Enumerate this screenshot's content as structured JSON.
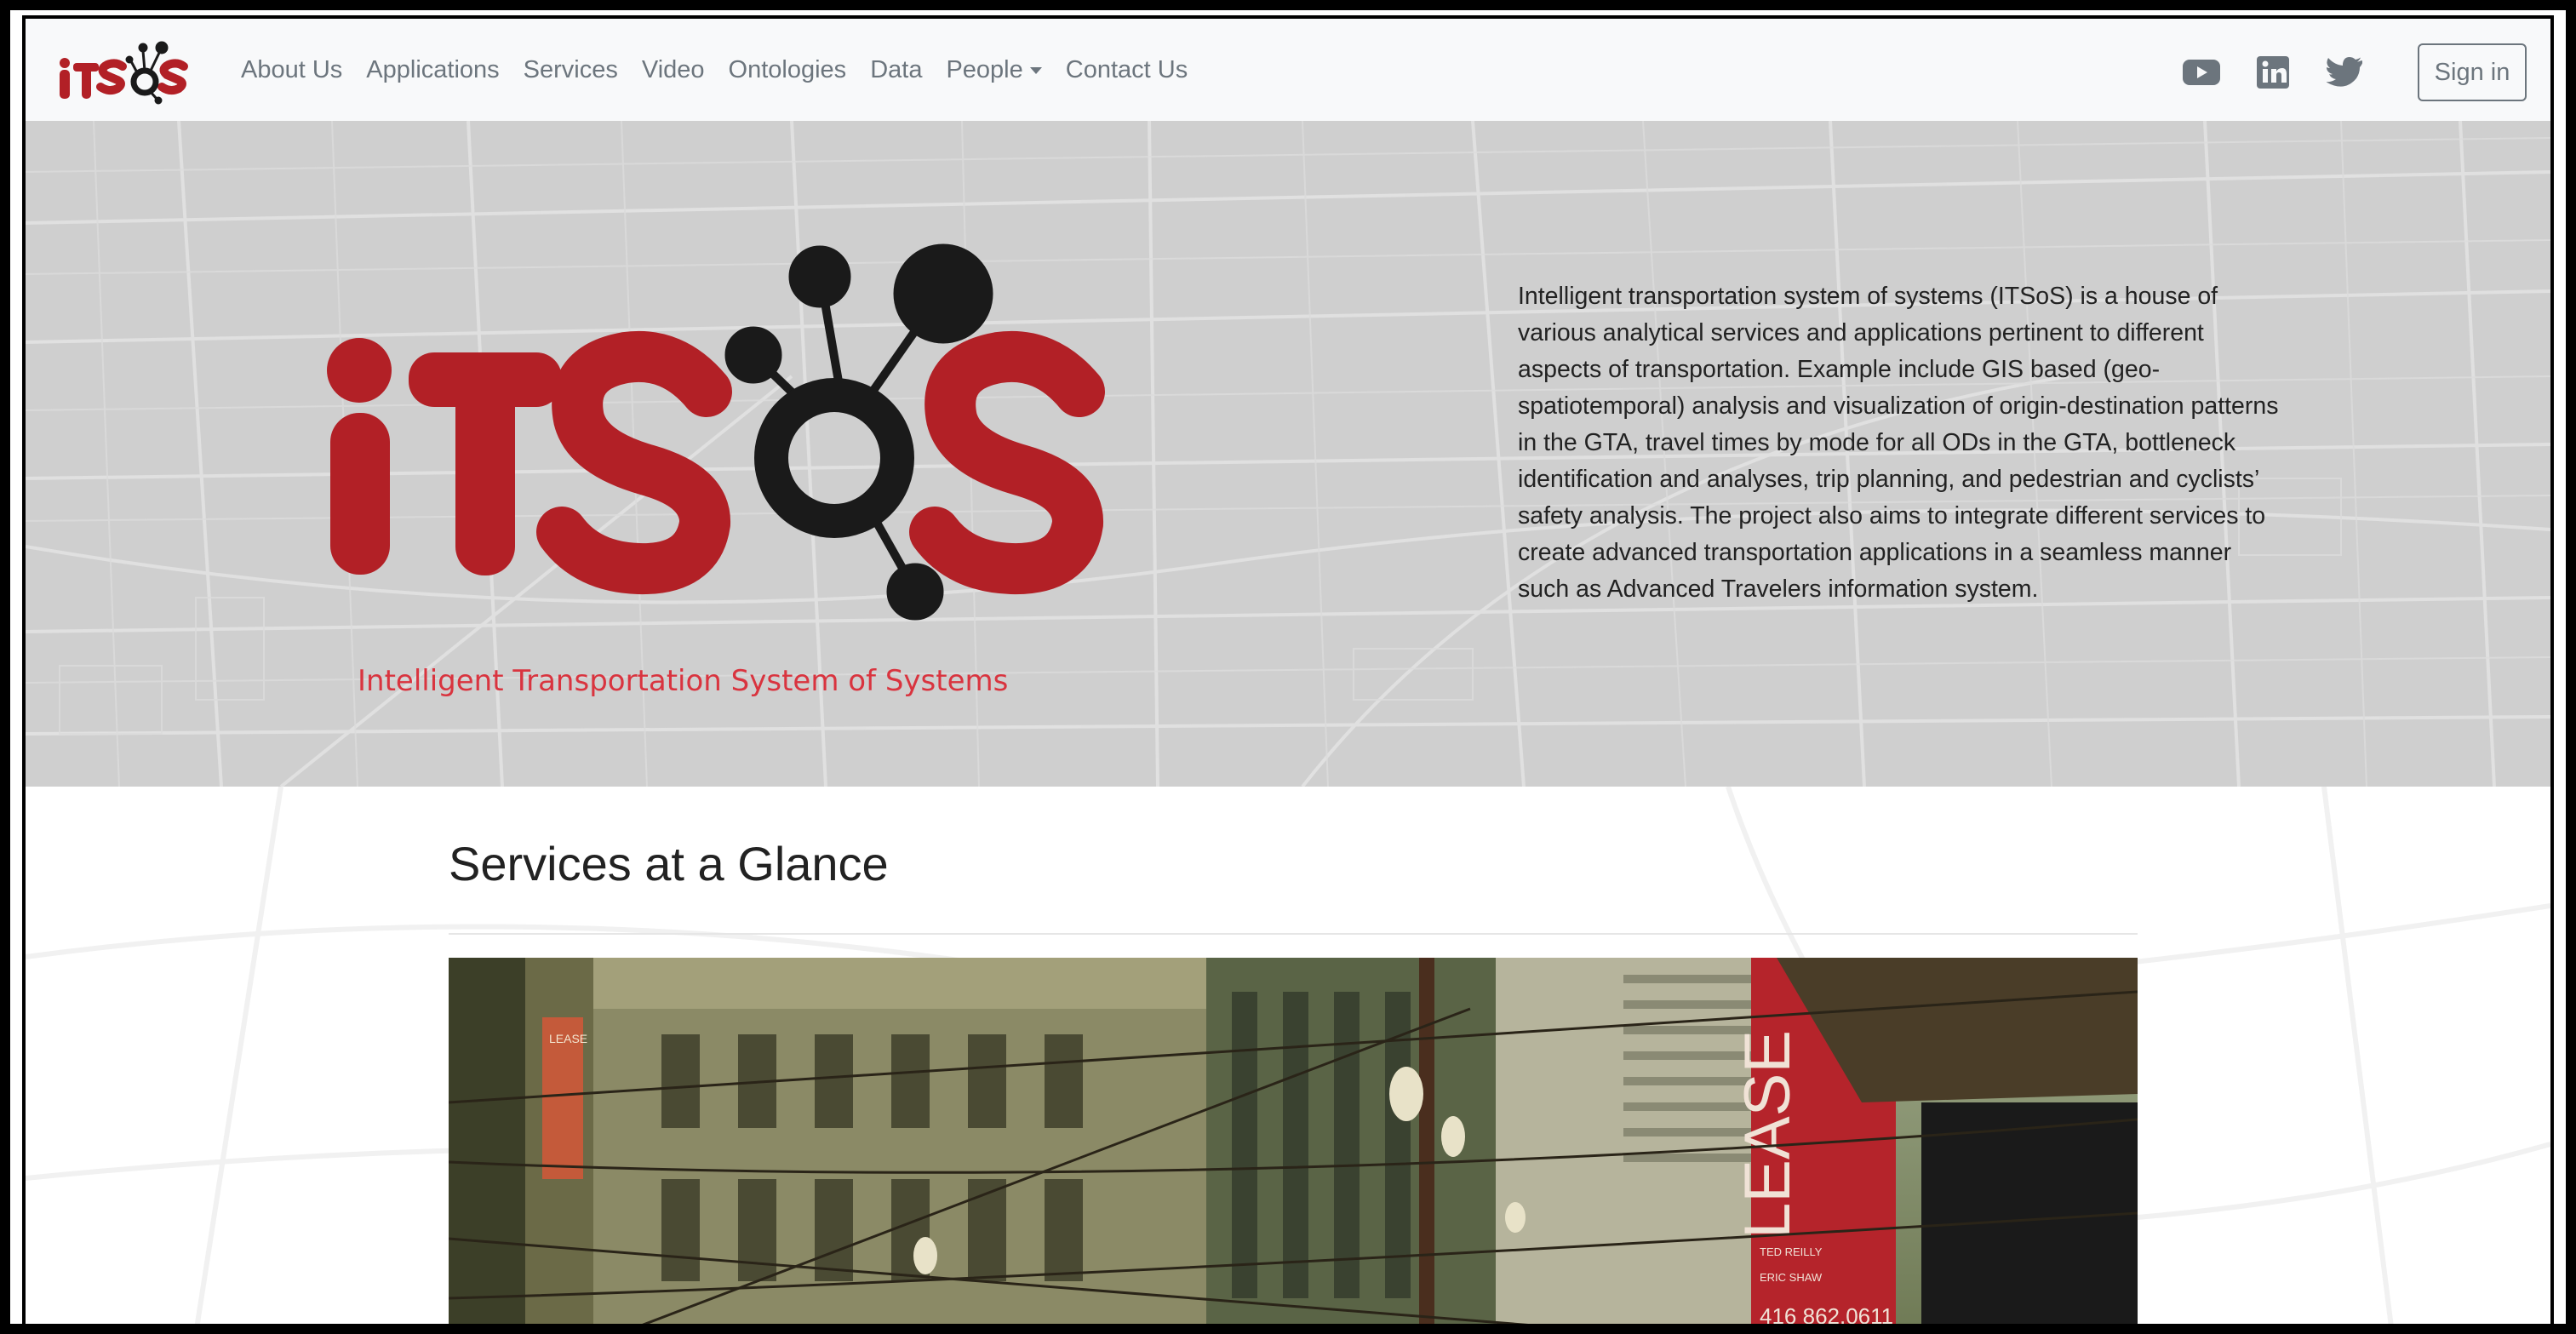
{
  "brand": {
    "logo_text": "iTSoS",
    "accent_color": "#b22026",
    "dark_color": "#1a1a1a"
  },
  "nav": {
    "links": [
      {
        "label": "About Us"
      },
      {
        "label": "Applications"
      },
      {
        "label": "Services"
      },
      {
        "label": "Video"
      },
      {
        "label": "Ontologies"
      },
      {
        "label": "Data"
      },
      {
        "label": "People",
        "has_dropdown": true
      },
      {
        "label": "Contact Us"
      }
    ],
    "social_icons": [
      "youtube-icon",
      "linkedin-icon",
      "twitter-icon"
    ],
    "signin_label": "Sign in"
  },
  "hero": {
    "logo_text": "iTSoS",
    "tagline": "Intelligent Transportation System of Systems",
    "description": "Intelligent transportation system of systems (ITSoS) is a house of various analytical services and applications pertinent to different aspects of transportation. Example include GIS based (geo-spatiotemporal) analysis and visualization of origin-destination patterns in the GTA, travel times by mode for all ODs in the GTA, bottleneck identification and analyses, trip planning, and pedestrian and cyclists’ safety analysis. The project also aims to integrate different services to create advanced transportation applications in a seamless manner such as Advanced Travelers information system."
  },
  "services": {
    "title": "Services at a Glance",
    "image": {
      "sign_word": "LEASE",
      "small_sign_word": "LEASE",
      "agent_1": "TED REILLY",
      "agent_2": "ERIC SHAW",
      "phone": "416 862.0611",
      "sign_color": "#b5242b"
    }
  }
}
